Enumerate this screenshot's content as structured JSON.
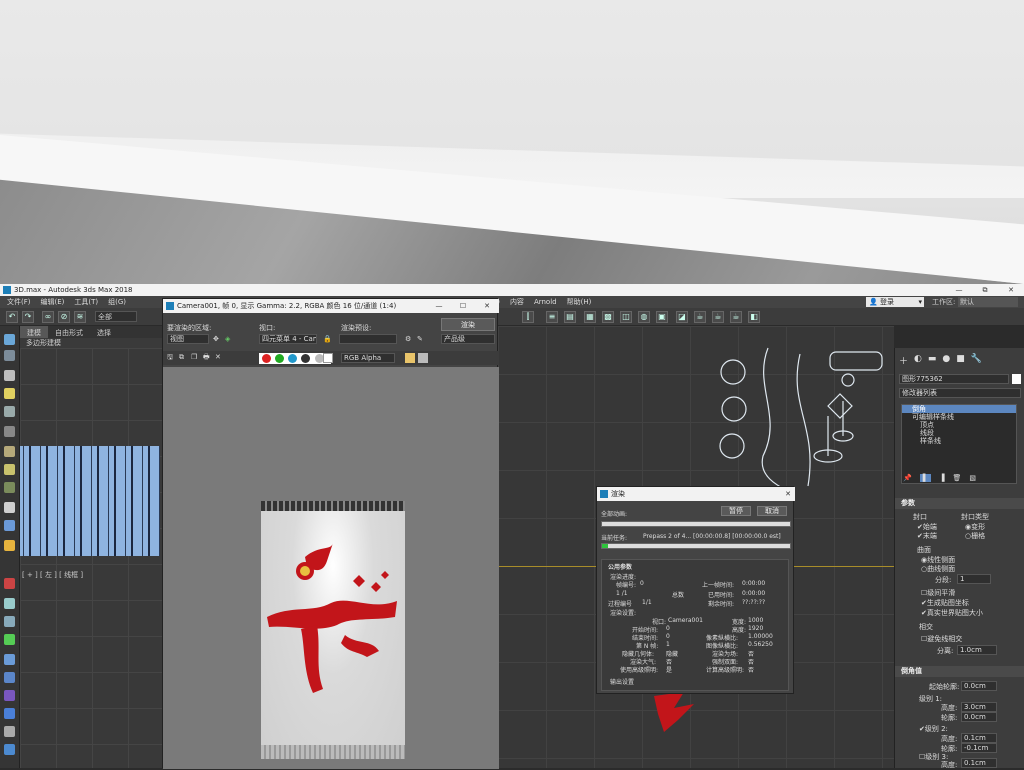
{
  "titlebar": {
    "title": "3D.max - Autodesk 3ds Max 2018",
    "min": "—",
    "max": "⧉",
    "close": "✕"
  },
  "menubar": {
    "items": [
      "文件(F)",
      "编辑(E)",
      "工具(T)",
      "组(G)",
      "脚本(S)",
      "内容",
      "Arnold",
      "帮助(H)"
    ],
    "login": "登录",
    "workspace_label": "工作区:",
    "workspace_value": "默认"
  },
  "toolbar": {
    "selection_set": "全部"
  },
  "ribbon": {
    "tabs": [
      "建模",
      "自由形式",
      "选择"
    ],
    "sub": "多边形建模"
  },
  "left_viewport": {
    "label": "[ + ] [ 左 ] [ 线框 ]"
  },
  "render_frame": {
    "title": "Camera001, 帧 0, 显示 Gamma: 2.2, RGBA 颜色 16 位/通道 (1:4)",
    "area_label": "要渲染的区域:",
    "area_value": "视图",
    "viewport_label": "视口:",
    "viewport_value": "四元菜单 4 - Camera001",
    "preset_label": "渲染预设:",
    "preset_value": "",
    "render_button": "渲染",
    "product_value": "产品级",
    "channel_value": "RGB Alpha"
  },
  "render_dialog": {
    "title": "渲染",
    "overall_label": "全部动画:",
    "pause": "暂停",
    "cancel": "取消",
    "current_task_label": "当前任务:",
    "current_task": "Prepass 2 of 4... [00:00:00.8] [00:00:00.0 est]",
    "progress": 0.03,
    "params_header": "公用参数",
    "progress_label": "渲染进度:",
    "frame_no_label": "帧编号:",
    "frame_no": "0",
    "frame_count": "1 /1",
    "total_label": "总数",
    "last_frame_label": "上一帧时间:",
    "last_frame": "0:00:00",
    "elapsed_label": "已用时间:",
    "elapsed": "0:00:00",
    "remaining_label": "剩余时间:",
    "remaining": "??:??:??",
    "pass_label": "过程编号",
    "pass": "1/1",
    "settings_label": "渲染设置:",
    "viewport_label": "视口:",
    "viewport": "Camera001",
    "width_label": "宽度:",
    "width": "1000",
    "start_label": "开始时间:",
    "start": "0",
    "height_label": "高度:",
    "height": "1920",
    "end_label": "结束时间:",
    "end": "0",
    "pixel_aspect_label": "像素纵横比:",
    "pixel_aspect": "1.00000",
    "nth_label": "第 N 帧:",
    "nth": "1",
    "image_aspect_label": "图像纵横比:",
    "image_aspect": "0.56250",
    "hidden_label": "隐藏几何体:",
    "hidden": "隐藏",
    "render_to_fields_label": "渲染为场:",
    "render_to_fields": "否",
    "atmos_label": "渲染大气:",
    "atmos": "否",
    "force_2side_label": "强制双面:",
    "force_2side": "否",
    "adv_light_label": "使用高级照明:",
    "adv_light": "是",
    "calc_adv_label": "计算高级照明:",
    "calc_adv": "否",
    "output_label": "输出设置"
  },
  "command_panel": {
    "object_name": "图形775362",
    "modifier_list": "修改器列表",
    "stack": [
      "倒角",
      "可编辑样条线",
      "顶点",
      "线段",
      "样条线"
    ],
    "params_header": "参数",
    "capping_label": "封口",
    "cap_start": "始端",
    "cap_end": "末端",
    "cap_type_label": "封口类型",
    "morph": "变形",
    "grid": "栅格",
    "surface_label": "曲面",
    "linear_sides": "线性侧面",
    "curved_sides": "曲线侧面",
    "segments_label": "分段:",
    "segments": "1",
    "smooth_across": "级间平滑",
    "gen_map": "生成贴图坐标",
    "real_world": "真实世界贴图大小",
    "intersect_label": "相交",
    "keep_lines": "避免线相交",
    "separation_label": "分离:",
    "separation": "1.0cm",
    "bevel_header": "倒角值",
    "start_outline_label": "起始轮廓:",
    "start_outline": "0.0cm",
    "level1_label": "级别 1:",
    "height_label": "高度:",
    "level1_height": "3.0cm",
    "outline_label": "轮廓:",
    "level1_outline": "0.0cm",
    "level2_label": "级别 2:",
    "level2_height": "0.1cm",
    "level2_outline": "-0.1cm",
    "level3_label": "级别 3:",
    "level3_height": "0.1cm"
  }
}
